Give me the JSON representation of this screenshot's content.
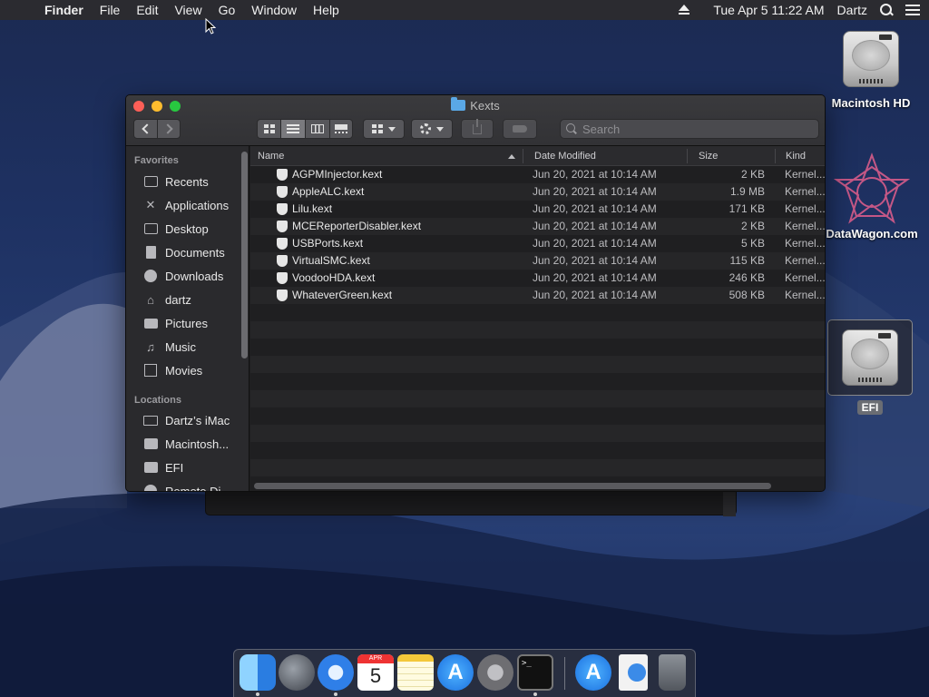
{
  "menubar": {
    "apple": "",
    "items": [
      "Finder",
      "File",
      "Edit",
      "View",
      "Go",
      "Window",
      "Help"
    ],
    "datetime": "Tue Apr 5  11:22 AM",
    "user": "Dartz"
  },
  "desktop": {
    "icons": [
      {
        "label": "Macintosh HD"
      },
      {
        "label": "DataWagon.com"
      },
      {
        "label": "EFI"
      }
    ]
  },
  "window": {
    "title": "Kexts",
    "search_placeholder": "Search"
  },
  "sidebar": {
    "favorites_label": "Favorites",
    "favorites": [
      {
        "label": "Recents",
        "icon": "clock-icon"
      },
      {
        "label": "Applications",
        "icon": "applications-icon"
      },
      {
        "label": "Desktop",
        "icon": "desktop-icon"
      },
      {
        "label": "Documents",
        "icon": "document-icon"
      },
      {
        "label": "Downloads",
        "icon": "download-icon"
      },
      {
        "label": "dartz",
        "icon": "home-icon"
      },
      {
        "label": "Pictures",
        "icon": "camera-icon"
      },
      {
        "label": "Music",
        "icon": "music-note-icon"
      },
      {
        "label": "Movies",
        "icon": "film-icon"
      }
    ],
    "locations_label": "Locations",
    "locations": [
      {
        "label": "Dartz’s iMac",
        "icon": "computer-icon"
      },
      {
        "label": "Macintosh...",
        "icon": "drive-icon"
      },
      {
        "label": "EFI",
        "icon": "drive-icon"
      },
      {
        "label": "Remote Di...",
        "icon": "disc-icon"
      }
    ]
  },
  "list": {
    "columns": {
      "name": "Name",
      "date": "Date Modified",
      "size": "Size",
      "kind": "Kind"
    },
    "rows": [
      {
        "name": "AGPMInjector.kext",
        "date": "Jun 20, 2021 at 10:14 AM",
        "size": "2 KB",
        "kind": "Kernel..."
      },
      {
        "name": "AppleALC.kext",
        "date": "Jun 20, 2021 at 10:14 AM",
        "size": "1.9 MB",
        "kind": "Kernel..."
      },
      {
        "name": "Lilu.kext",
        "date": "Jun 20, 2021 at 10:14 AM",
        "size": "171 KB",
        "kind": "Kernel..."
      },
      {
        "name": "MCEReporterDisabler.kext",
        "date": "Jun 20, 2021 at 10:14 AM",
        "size": "2 KB",
        "kind": "Kernel..."
      },
      {
        "name": "USBPorts.kext",
        "date": "Jun 20, 2021 at 10:14 AM",
        "size": "5 KB",
        "kind": "Kernel..."
      },
      {
        "name": "VirtualSMC.kext",
        "date": "Jun 20, 2021 at 10:14 AM",
        "size": "115 KB",
        "kind": "Kernel..."
      },
      {
        "name": "VoodooHDA.kext",
        "date": "Jun 20, 2021 at 10:14 AM",
        "size": "246 KB",
        "kind": "Kernel..."
      },
      {
        "name": "WhateverGreen.kext",
        "date": "Jun 20, 2021 at 10:14 AM",
        "size": "508 KB",
        "kind": "Kernel..."
      }
    ]
  },
  "dock": {
    "calendar_month": "APR",
    "calendar_day": "5",
    "terminal_prompt": ">_"
  }
}
